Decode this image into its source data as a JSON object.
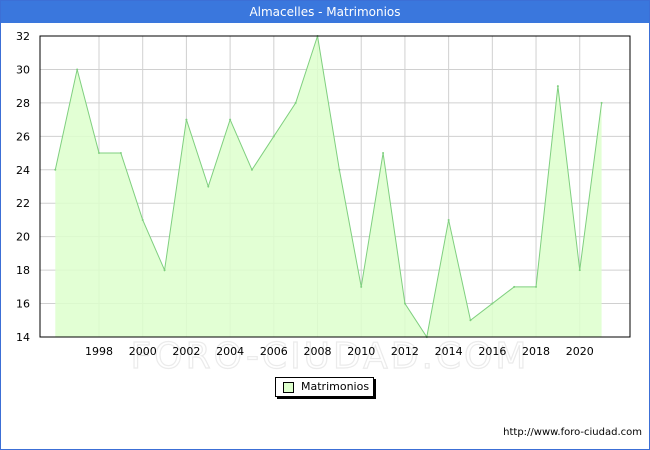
{
  "header": {
    "title": "Almacelles - Matrimonios"
  },
  "watermark": "FORO-CIUDAD.COM",
  "footer": {
    "url": "http://www.foro-ciudad.com"
  },
  "colors": {
    "title_bar": "#3a77dd",
    "fill": "#ddffcc",
    "line": "#7fcf7f",
    "grid": "#d0d0d0"
  },
  "chart_data": {
    "type": "area",
    "title": "Almacelles - Matrimonios",
    "xlabel": "",
    "ylabel": "",
    "x": [
      1996,
      1997,
      1998,
      1999,
      2000,
      2001,
      2002,
      2003,
      2004,
      2005,
      2006,
      2007,
      2008,
      2009,
      2010,
      2011,
      2012,
      2013,
      2014,
      2015,
      2016,
      2017,
      2018,
      2019,
      2020,
      2021
    ],
    "series": [
      {
        "name": "Matrimonios",
        "values": [
          24,
          30,
          25,
          25,
          21,
          18,
          27,
          23,
          27,
          24,
          26,
          28,
          32,
          24,
          17,
          25,
          16,
          14,
          21,
          15,
          16,
          17,
          17,
          29,
          18,
          28
        ]
      }
    ],
    "xlim": [
      1995.3,
      2022.3
    ],
    "ylim": [
      14,
      32
    ],
    "xticks": [
      "1998",
      "2000",
      "2002",
      "2004",
      "2006",
      "2008",
      "2010",
      "2012",
      "2014",
      "2016",
      "2018",
      "2020"
    ],
    "yticks": [
      "14",
      "16",
      "18",
      "20",
      "22",
      "24",
      "26",
      "28",
      "30",
      "32"
    ],
    "grid": true,
    "legend": {
      "placement": "bottom-center",
      "entries": [
        "Matrimonios"
      ]
    }
  }
}
